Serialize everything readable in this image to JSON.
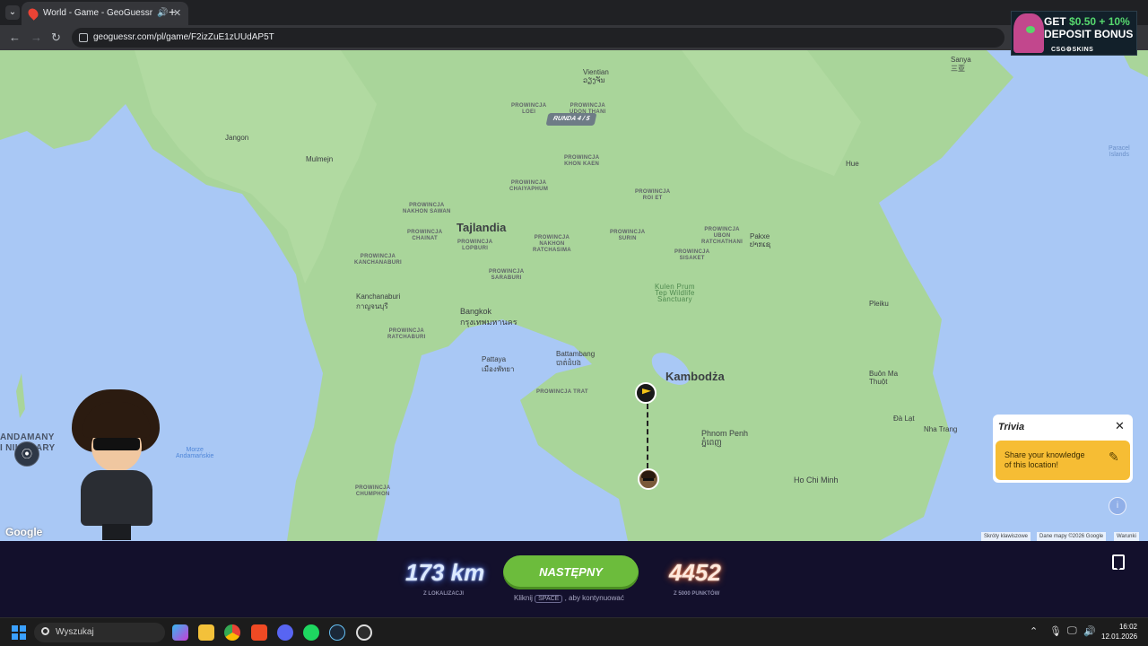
{
  "browser": {
    "tab_title": "World - Game - GeoGuessr",
    "tab_close": "✕",
    "new_tab": "+",
    "url": "geoguessr.com/pl/game/F2izZuE1zUUdAP5T"
  },
  "ad": {
    "line1_a": "GET ",
    "line1_b": "$0.50 + 10%",
    "line2": "DEPOSIT BONUS",
    "brand": "CSG⚙SKINS"
  },
  "map": {
    "round": "RUNDA 4 / 5",
    "countries": [
      "Tajlandia",
      "Kambodża"
    ],
    "cities": [
      {
        "name": "Vientian",
        "sub": "ວຽງຈັນ"
      },
      {
        "name": "Bangkok",
        "sub": "กรุงเทพมหานคร"
      },
      {
        "name": "Phnom Penh",
        "sub": "ភ្នំពេញ"
      },
      {
        "name": "Ho Chi Minh",
        "sub": ""
      },
      {
        "name": "Hue",
        "sub": ""
      },
      {
        "name": "Pakxe",
        "sub": "ປາກເຊ"
      },
      {
        "name": "Pattaya",
        "sub": "เมืองพัทยา"
      },
      {
        "name": "Battambang",
        "sub": "បាត់ដំបង"
      },
      {
        "name": "Kanchanaburi",
        "sub": "กาญจนบุรี"
      },
      {
        "name": "Jangon",
        "sub": ""
      },
      {
        "name": "Mulmejn",
        "sub": ""
      },
      {
        "name": "Sanya",
        "sub": "三亚"
      },
      {
        "name": "Pleiku",
        "sub": ""
      },
      {
        "name": "Buôn Ma Thuột",
        "sub": ""
      },
      {
        "name": "Đà Lạt",
        "sub": ""
      },
      {
        "name": "Nha Trang",
        "sub": ""
      }
    ],
    "provinces": [
      "PROWINCJA\nUDON THANI",
      "PROWINCJA\nKHON KAEN",
      "PROWINCJA\nNAKHON\nRATCHASIMA",
      "PROWINCJA\nCHAIYAPHUM",
      "PROWINCJA\nROI ET",
      "PROWINCJA\nSURIN",
      "PROWINCJA\nLOEI",
      "PROWINCJA\nKANCHANABURI",
      "PROWINCJA\nSISAKET",
      "PROWINCJA\nUBON\nRATCHATHANI",
      "PROWINCJA\nNAKHON SAWAN",
      "PROWINCJA\nCHAINAT",
      "PROWINCJA\nLOPBURI",
      "PROWINCJA\nSARABURI",
      "PROWINCJA\nRATCHABURI",
      "PROWINCJA TRAT",
      "PROWINCJA\nCHUMPHON"
    ],
    "park": "Kulen Prum\nTep Wildlife\nSanctuary",
    "seas": [
      "Morze\nAndamańskie",
      "Paracel\nIslands"
    ],
    "left_edge": "ANDAMANY\nI NIKOBARY",
    "footer": [
      "Skróty klawiszowe",
      "Dane mapy ©2026 Google",
      "Warunki"
    ],
    "google": "Google"
  },
  "trivia": {
    "title": "Trivia",
    "close": "✕",
    "prompt": "Share your knowledge\nof this location!"
  },
  "result": {
    "distance": "173 km",
    "distance_sub": "Z LOKALIZACJI",
    "next_label": "NASTĘPNY",
    "hint_before": "Kliknij",
    "hint_key": "SPACE",
    "hint_after": ", aby kontynuować",
    "score": "4452",
    "score_sub": "Z 5000 PUNKTÓW"
  },
  "taskbar": {
    "search_placeholder": "Wyszukaj",
    "time": "16:02",
    "date": "12.01.2026"
  },
  "colors": {
    "land": "#a9d59a",
    "water": "#a9c8f5",
    "next_button": "#6cbc3c",
    "trivia_box": "#f6bd34",
    "game_bar": "#13102c"
  }
}
